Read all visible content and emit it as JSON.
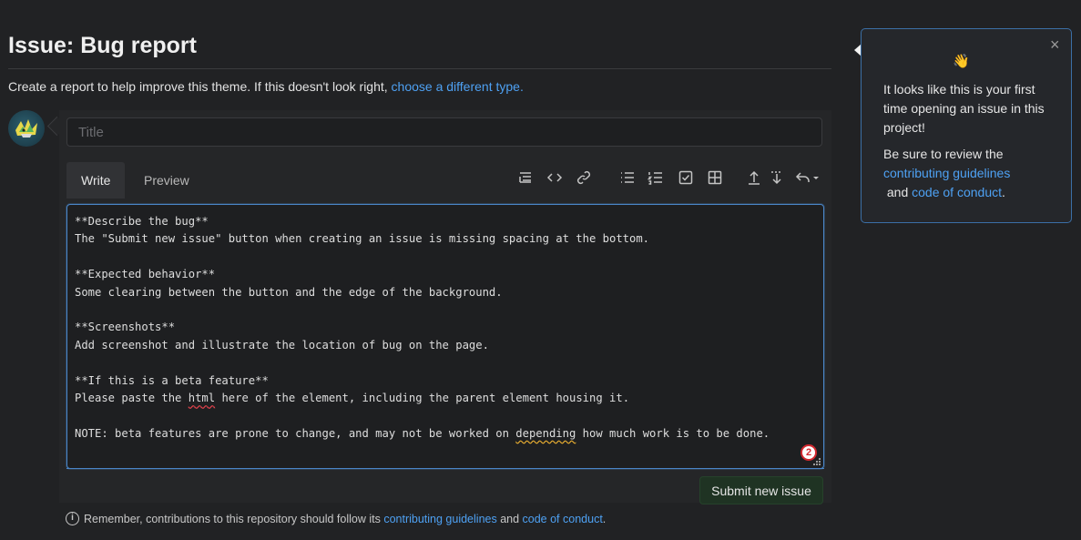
{
  "page": {
    "title": "Issue: Bug report",
    "subtitle_text": "Create a report to help improve this theme. If this doesn't look right, ",
    "subtitle_link": "choose a different type."
  },
  "form": {
    "title_placeholder": "Title",
    "tabs": [
      {
        "label": "Write",
        "active": true
      },
      {
        "label": "Preview",
        "active": false
      }
    ],
    "toolbar_icons": [
      "heading-icon",
      "code-icon",
      "link-icon",
      "bulleted-list-icon",
      "numbered-list-icon",
      "task-list-icon",
      "table-icon",
      "upload-icon",
      "download-icon",
      "undo-icon"
    ],
    "body_lines": [
      "**Describe the bug**",
      "The \"Submit new issue\" button when creating an issue is missing spacing at the bottom.",
      "",
      "**Expected behavior**",
      "Some clearing between the button and the edge of the background.",
      "",
      "**Screenshots**",
      "Add screenshot and illustrate the location of bug on the page.",
      "",
      "**If this is a beta feature**",
      "Please paste the ",
      "html",
      " here of the element, including the parent element housing it.",
      "",
      "NOTE: beta features are prone to change, and may not be worked on ",
      "depending",
      " how much work is to be done."
    ],
    "spellcheck_count": "2",
    "submit_label": "Submit new issue"
  },
  "footer": {
    "text_before": "Remember, contributions to this repository should follow its ",
    "link_guidelines": "contributing guidelines",
    "text_and": " and ",
    "link_conduct": "code of conduct",
    "text_end": "."
  },
  "popover": {
    "emoji": "👋",
    "line1": "It looks like this is your first time opening an issue in this project!",
    "line2_before": "Be sure to review the ",
    "link_guidelines": "contributing guidelines",
    "line2_and": " and ",
    "link_conduct": "code of conduct",
    "line2_end": ".",
    "close": "×"
  },
  "colors": {
    "background": "#212224",
    "link": "#4ea1f3",
    "editor_border": "#4a86c8",
    "submit_bg": "#1f3323",
    "badge": "#d3282f"
  }
}
